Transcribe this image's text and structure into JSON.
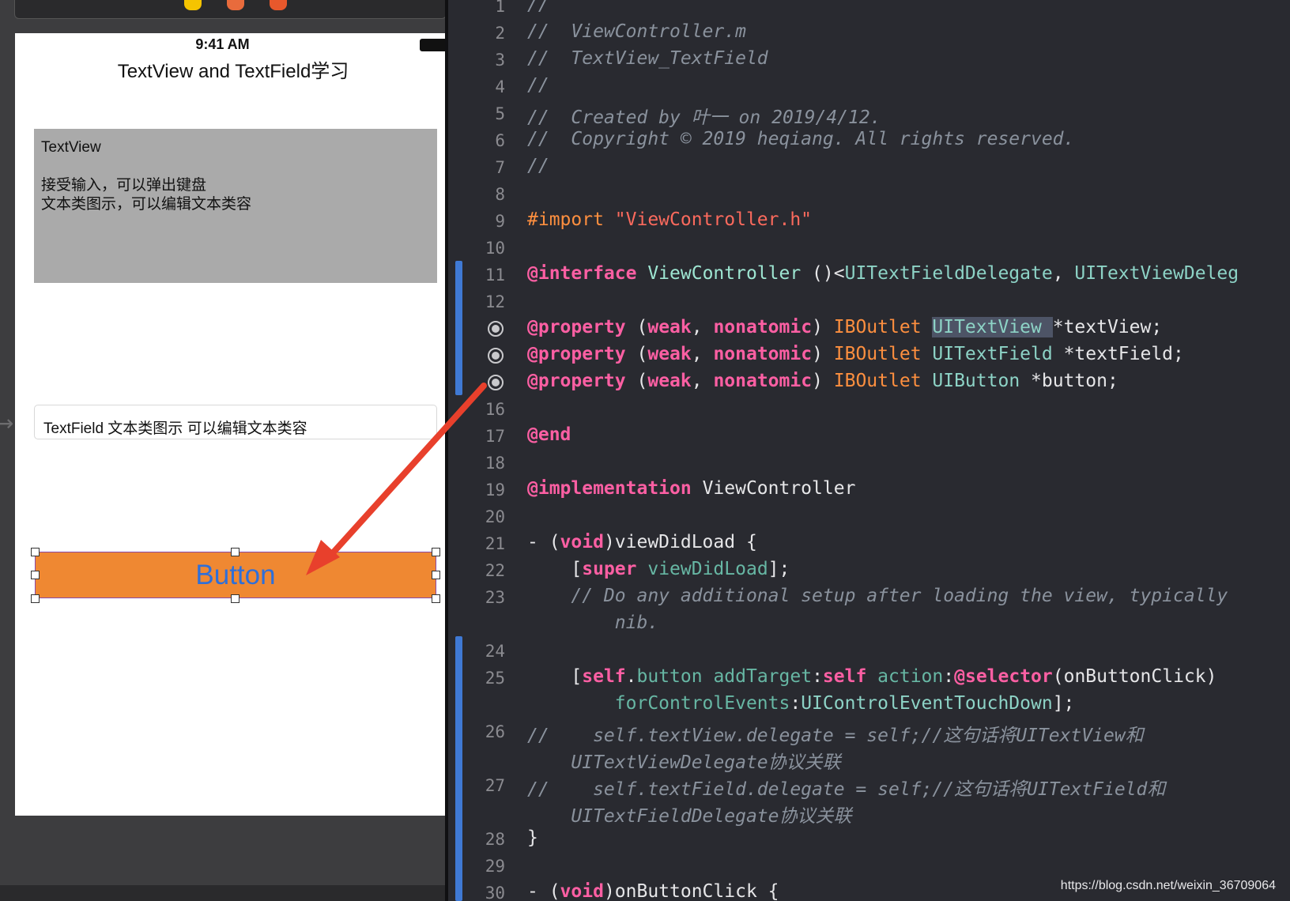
{
  "simulator": {
    "status_time": "9:41 AM",
    "nav_title": "TextView and TextField学习",
    "textview_lines": [
      "TextView",
      "",
      "接受输入，可以弹出键盘",
      "文本类图示，可以编辑文本类容"
    ],
    "textfield_text": "TextField 文本类图示 可以编辑文本类容",
    "button_label": "Button"
  },
  "editor": {
    "lines": [
      {
        "n": "1",
        "segs": [
          [
            "//",
            "cm"
          ]
        ]
      },
      {
        "n": "2",
        "segs": [
          [
            "//  ViewController.m",
            "cm"
          ]
        ]
      },
      {
        "n": "3",
        "segs": [
          [
            "//  TextView_TextField",
            "cm"
          ]
        ]
      },
      {
        "n": "4",
        "segs": [
          [
            "//",
            "cm"
          ]
        ]
      },
      {
        "n": "5",
        "segs": [
          [
            "//  Created by 叶一 on 2019/4/12.",
            "cm"
          ]
        ]
      },
      {
        "n": "6",
        "segs": [
          [
            "//  Copyright © 2019 heqiang. All rights reserved.",
            "cm"
          ]
        ]
      },
      {
        "n": "7",
        "segs": [
          [
            "//",
            "cm"
          ]
        ]
      },
      {
        "n": "8",
        "segs": []
      },
      {
        "n": "9",
        "segs": [
          [
            "#import ",
            "pp"
          ],
          [
            "\"ViewController.h\"",
            "st"
          ]
        ]
      },
      {
        "n": "10",
        "segs": []
      },
      {
        "n": "11",
        "segs": [
          [
            "@interface ",
            "kw"
          ],
          [
            "ViewController",
            "pl"
          ],
          [
            " ()<",
            ""
          ],
          [
            "UITextFieldDelegate",
            "ty"
          ],
          [
            ", ",
            ""
          ],
          [
            "UITextViewDeleg",
            "ty"
          ]
        ]
      },
      {
        "n": "12",
        "segs": []
      },
      {
        "n": "13",
        "segs": [
          [
            "@property ",
            "kw"
          ],
          [
            "(",
            ""
          ],
          [
            "weak",
            "kw"
          ],
          [
            ", ",
            ""
          ],
          [
            "nonatomic",
            "kw"
          ],
          [
            ") ",
            ""
          ],
          [
            "IBOutlet ",
            "pp"
          ],
          [
            "UITextView ",
            "ty sel"
          ],
          [
            "*textView;",
            ""
          ]
        ]
      },
      {
        "n": "14",
        "segs": [
          [
            "@property ",
            "kw"
          ],
          [
            "(",
            ""
          ],
          [
            "weak",
            "kw"
          ],
          [
            ", ",
            ""
          ],
          [
            "nonatomic",
            "kw"
          ],
          [
            ") ",
            ""
          ],
          [
            "IBOutlet ",
            "pp"
          ],
          [
            "UITextField ",
            "ty"
          ],
          [
            "*textField;",
            ""
          ]
        ]
      },
      {
        "n": "15",
        "segs": [
          [
            "@property ",
            "kw"
          ],
          [
            "(",
            ""
          ],
          [
            "weak",
            "kw"
          ],
          [
            ", ",
            ""
          ],
          [
            "nonatomic",
            "kw"
          ],
          [
            ") ",
            ""
          ],
          [
            "IBOutlet ",
            "pp"
          ],
          [
            "UIButton ",
            "ty"
          ],
          [
            "*button;",
            ""
          ]
        ]
      },
      {
        "n": "16",
        "segs": []
      },
      {
        "n": "17",
        "segs": [
          [
            "@end",
            "kw"
          ]
        ]
      },
      {
        "n": "18",
        "segs": []
      },
      {
        "n": "19",
        "segs": [
          [
            "@implementation ",
            "kw"
          ],
          [
            "ViewController",
            ""
          ]
        ]
      },
      {
        "n": "20",
        "segs": []
      },
      {
        "n": "21",
        "segs": [
          [
            "- (",
            ""
          ],
          [
            "void",
            "kw"
          ],
          [
            ")viewDidLoad {",
            ""
          ]
        ]
      },
      {
        "n": "22",
        "segs": [
          [
            "    [",
            ""
          ],
          [
            "super ",
            "kw"
          ],
          [
            "viewDidLoad",
            "me"
          ],
          [
            "];",
            ""
          ]
        ]
      },
      {
        "n": "23",
        "segs": [
          [
            "    // Do any additional setup after loading the view, typically",
            "cm"
          ]
        ]
      },
      {
        "n": "",
        "segs": [
          [
            "        nib.",
            "cm"
          ]
        ]
      },
      {
        "n": "24",
        "segs": []
      },
      {
        "n": "25",
        "segs": [
          [
            "    [",
            ""
          ],
          [
            "self",
            "kw"
          ],
          [
            ".",
            ""
          ],
          [
            "button ",
            "me"
          ],
          [
            "addTarget",
            "me"
          ],
          [
            ":",
            ""
          ],
          [
            "self ",
            "kw"
          ],
          [
            "action",
            "me"
          ],
          [
            ":",
            ""
          ],
          [
            "@selector",
            "kw"
          ],
          [
            "(onButtonClick)",
            ""
          ]
        ]
      },
      {
        "n": "",
        "segs": [
          [
            "        ",
            ""
          ],
          [
            "forControlEvents",
            "me"
          ],
          [
            ":",
            ""
          ],
          [
            "UIControlEventTouchDown",
            "ty"
          ],
          [
            "];",
            ""
          ]
        ]
      },
      {
        "n": "26",
        "segs": [
          [
            "//    self.textView.delegate = self;//这句话将UITextView和",
            "cm"
          ]
        ]
      },
      {
        "n": "",
        "segs": [
          [
            "    UITextViewDelegate协议关联",
            "cm"
          ]
        ]
      },
      {
        "n": "27",
        "segs": [
          [
            "//    self.textField.delegate = self;//这句话将UITextField和",
            "cm"
          ]
        ]
      },
      {
        "n": "",
        "segs": [
          [
            "    UITextFieldDelegate协议关联",
            "cm"
          ]
        ]
      },
      {
        "n": "28",
        "segs": [
          [
            "}",
            ""
          ]
        ]
      },
      {
        "n": "29",
        "segs": []
      },
      {
        "n": "30",
        "segs": [
          [
            "- (",
            ""
          ],
          [
            "void",
            "kw"
          ],
          [
            ")onButtonClick {",
            ""
          ]
        ]
      }
    ]
  },
  "watermark": "https://blog.csdn.net/weixin_36709064",
  "colors": {
    "accent_arrow": "#e8402c",
    "button_fill": "#ef8832",
    "button_text": "#2e6fd9",
    "change_bar": "#3f79d4"
  }
}
